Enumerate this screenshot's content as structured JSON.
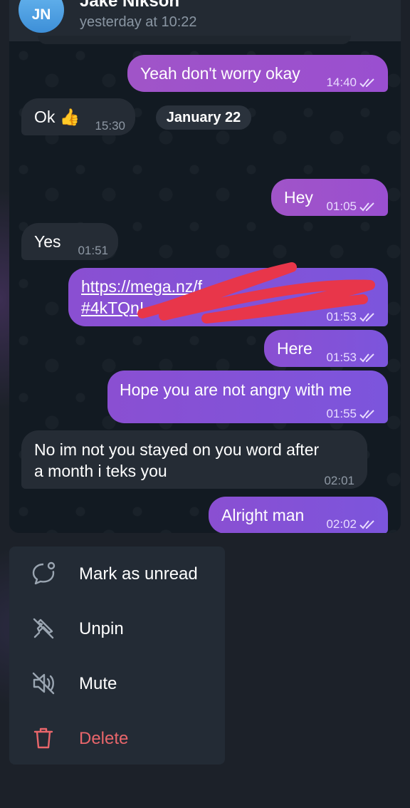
{
  "header": {
    "avatar_initials": "JN",
    "contact_name": "Jake Nikson",
    "last_seen": "yesterday at 10:22"
  },
  "date_separator": "January 22",
  "messages": [
    {
      "direction": "out",
      "text": "Yeah don't worry okay",
      "time": "14:40",
      "read": true
    },
    {
      "direction": "in",
      "text": "Ok 👍",
      "time": "15:30"
    },
    {
      "direction": "out",
      "text": "Hey",
      "time": "01:05",
      "read": true
    },
    {
      "direction": "in",
      "text": "Yes",
      "time": "01:51"
    },
    {
      "direction": "out",
      "text_line1": "https://mega.nz/f",
      "text_line2": "#4kTQnI",
      "time": "01:53",
      "read": true,
      "redacted": true
    },
    {
      "direction": "out",
      "text": "Here",
      "time": "01:53",
      "read": true
    },
    {
      "direction": "out",
      "text": "Hope you are not angry with me",
      "time": "01:55",
      "read": true
    },
    {
      "direction": "in",
      "text_line1": "No im not you stayed on you word after",
      "text_line2": "a month i teks you",
      "time": "02:01"
    },
    {
      "direction": "out",
      "text": "Alright man",
      "time": "02:02",
      "read": true
    }
  ],
  "context_menu": [
    {
      "label": "Mark as unread",
      "icon": "unread-bubble-icon"
    },
    {
      "label": "Unpin",
      "icon": "unpin-icon"
    },
    {
      "label": "Mute",
      "icon": "mute-icon"
    },
    {
      "label": "Delete",
      "icon": "trash-icon",
      "color": "#e9666b"
    }
  ],
  "colors": {
    "outgoing_bubble": "#8a4fd2",
    "incoming_bubble": "#252c35",
    "danger": "#e9666b",
    "background": "#1c2129"
  }
}
